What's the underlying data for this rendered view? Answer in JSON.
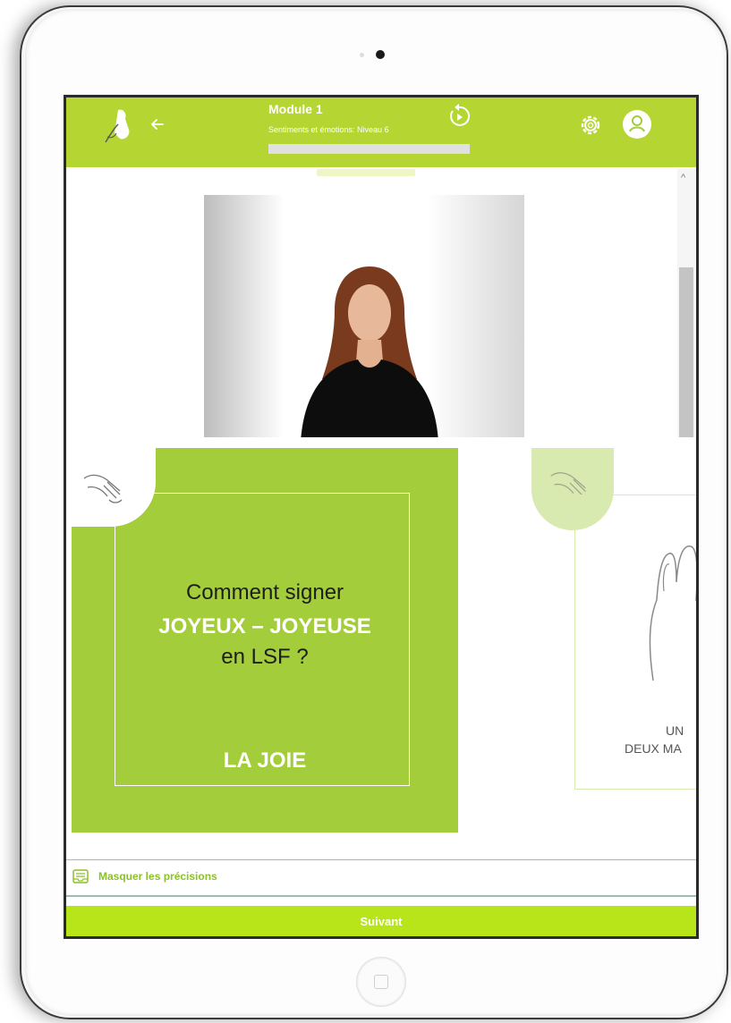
{
  "header": {
    "module_title": "Module 1",
    "module_subtitle": "Sentiments et émotions: Niveau 6",
    "progress": 0.0
  },
  "icons": {
    "logo": "hand-logo-icon",
    "back": "arrow-left-icon",
    "replay": "replay-icon",
    "settings": "gear-icon",
    "profile": "user-icon"
  },
  "card_main": {
    "line1": "Comment signer",
    "line2": "JOYEUX – JOYEUSE",
    "line3": "en LSF ?",
    "answer": "LA JOIE"
  },
  "card_next": {
    "text1": "UN",
    "text2": "DEUX MA"
  },
  "footer": {
    "toggle_label": "Masquer les précisions",
    "next_button": "Suivant"
  },
  "colors": {
    "accent": "#b5d533",
    "card": "#a4cd3c",
    "button": "#b8e51a"
  }
}
